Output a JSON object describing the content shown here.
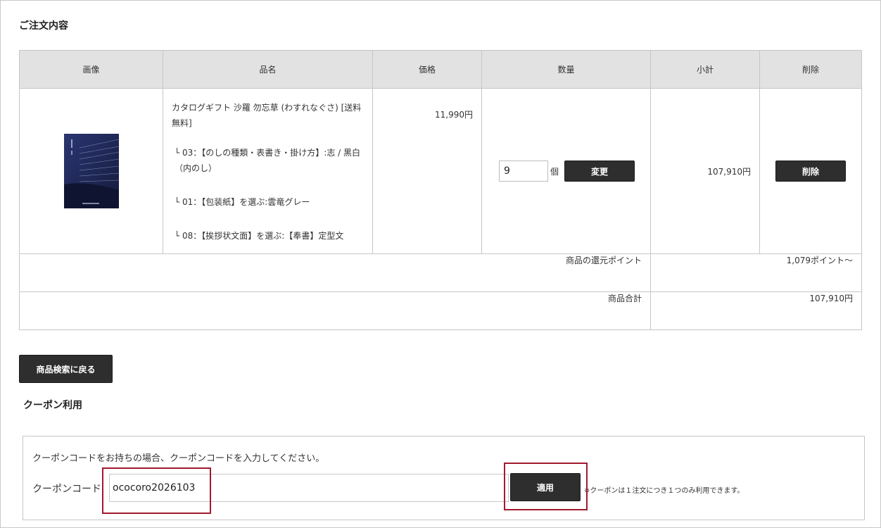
{
  "order": {
    "title": "ご注文内容",
    "headers": [
      "画像",
      "品名",
      "価格",
      "数量",
      "小計",
      "削除"
    ],
    "item": {
      "name": "カタログギフト 沙羅 勿忘草 (わすれなぐさ) [送料無料]",
      "options": [
        "└ 03：【のしの種類・表書き・掛け方】:志 / 黒白（内のし）",
        "└ 01：【包装紙】を選ぶ:雲竜グレー",
        "└ 08：【挨拶状文面】を選ぶ:【奉書】定型文"
      ],
      "price": "11,990円",
      "quantity": "9",
      "unit": "個",
      "change_label": "変更",
      "subtotal": "107,910円",
      "delete_label": "削除"
    },
    "points_label": "商品の還元ポイント",
    "points_value": "1,079ポイント〜",
    "total_label": "商品合計",
    "total_value": "107,910円"
  },
  "back_label": "商品検索に戻る",
  "coupon": {
    "title": "クーポン利用",
    "description": "クーポンコードをお持ちの場合、クーポンコードを入力してください。",
    "label": "クーポンコード",
    "value": "ococoro2026103",
    "apply_label": "適用",
    "note": "※クーポンは１注文につき１つのみ利用できます。"
  },
  "colors": {
    "header_bg": "#e2e2e2",
    "button_bg": "#2e2e2e",
    "highlight": "#a3192f"
  }
}
